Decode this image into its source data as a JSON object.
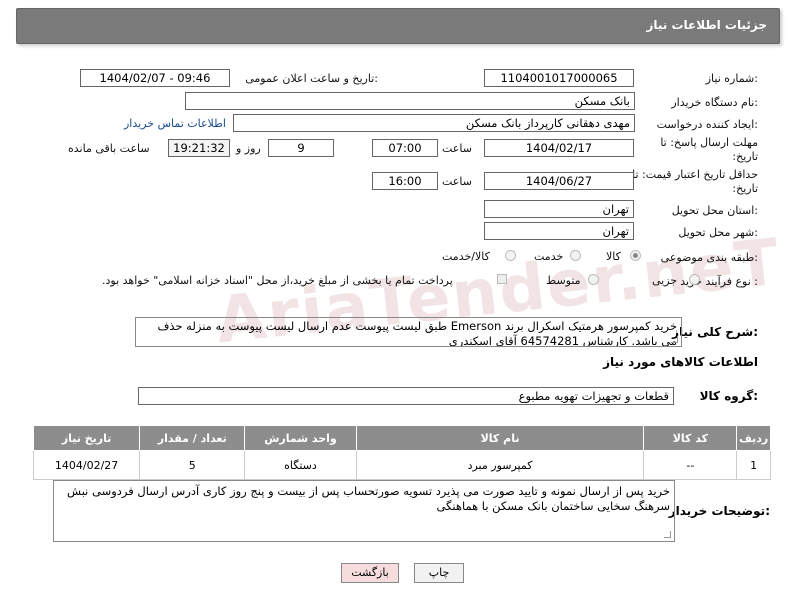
{
  "header": {
    "title": "جزئیات اطلاعات نیاز"
  },
  "fields": {
    "need_number_label": "شماره نیاز:",
    "need_number": "1104001017000065",
    "announce_label": "تاریخ و ساعت اعلان عمومی:",
    "announce_value": "1404/02/07 - 09:46",
    "buyer_org_label": "نام دستگاه خریدار:",
    "buyer_org": "بانک مسکن",
    "creator_label": "ایجاد کننده درخواست:",
    "creator": "مهدی دهقانی کارپرداز بانک مسکن",
    "contact_link": "اطلاعات تماس خریدار",
    "deadline_label": "مهلت ارسال پاسخ: تا تاریخ:",
    "deadline_date": "1404/02/17",
    "time_label": "ساعت",
    "deadline_time": "07:00",
    "days": "9",
    "days_label": "روز و",
    "remaining": "19:21:32",
    "remaining_label": "ساعت باقی مانده",
    "validity_label": "حداقل تاریخ اعتبار قیمت: تا تاریخ:",
    "validity_date": "1404/06/27",
    "validity_time": "16:00",
    "province_label": "استان محل تحویل:",
    "province": "تهران",
    "city_label": "شهر محل تحویل:",
    "city": "تهران",
    "category_label": "طبقه بندی موضوعی:",
    "cat_goods": "کالا",
    "cat_service": "خدمت",
    "cat_both": "کالا/خدمت",
    "process_label": "نوع فرآیند خرید :",
    "proc_small": "جزیی",
    "proc_medium": "متوسط",
    "payment_note": "پرداخت تمام یا بخشی از مبلغ خرید،از محل \"اسناد خزانه اسلامی\" خواهد بود.",
    "desc_label": "شرح کلی نیاز:",
    "desc_text": "خرید کمپرسور هرمتیک اسکرال برند Emerson طبق لیست پیوست عدم ارسال لیست پیوست به منزله حذف می باشد. کارشناس  64574281 آقای اسکندری",
    "goods_info_title": "اطلاعات کالاهای مورد نیاز",
    "group_label": "گروه کالا:",
    "group_value": "قطعات و تجهیزات تهویه مطبوع",
    "buyer_notes_label": "توضیحات خریدار:",
    "buyer_notes": "خرید پس از ارسال نمونه و تایید صورت می پذیرد تسویه صورتحساب پس از  بیست و پنج روز کاری آدرس ارسال فردوسی نبش سرهنگ سخایی ساختمان بانک مسکن با هماهنگی"
  },
  "table": {
    "headers": [
      "ردیف",
      "کد کالا",
      "نام کالا",
      "واحد شمارش",
      "تعداد / مقدار",
      "تاریخ نیاز"
    ],
    "rows": [
      {
        "idx": "1",
        "code": "--",
        "name": "کمپرسور مبرد",
        "unit": "دستگاه",
        "qty": "5",
        "date": "1404/02/27"
      }
    ]
  },
  "buttons": {
    "print": "چاپ",
    "back": "بازگشت"
  },
  "watermark": "AriaTender.neT",
  "colors": {
    "header_bg": "#7a7a7a",
    "link": "#1a4b8c",
    "back_btn": "#f6dcdc"
  }
}
